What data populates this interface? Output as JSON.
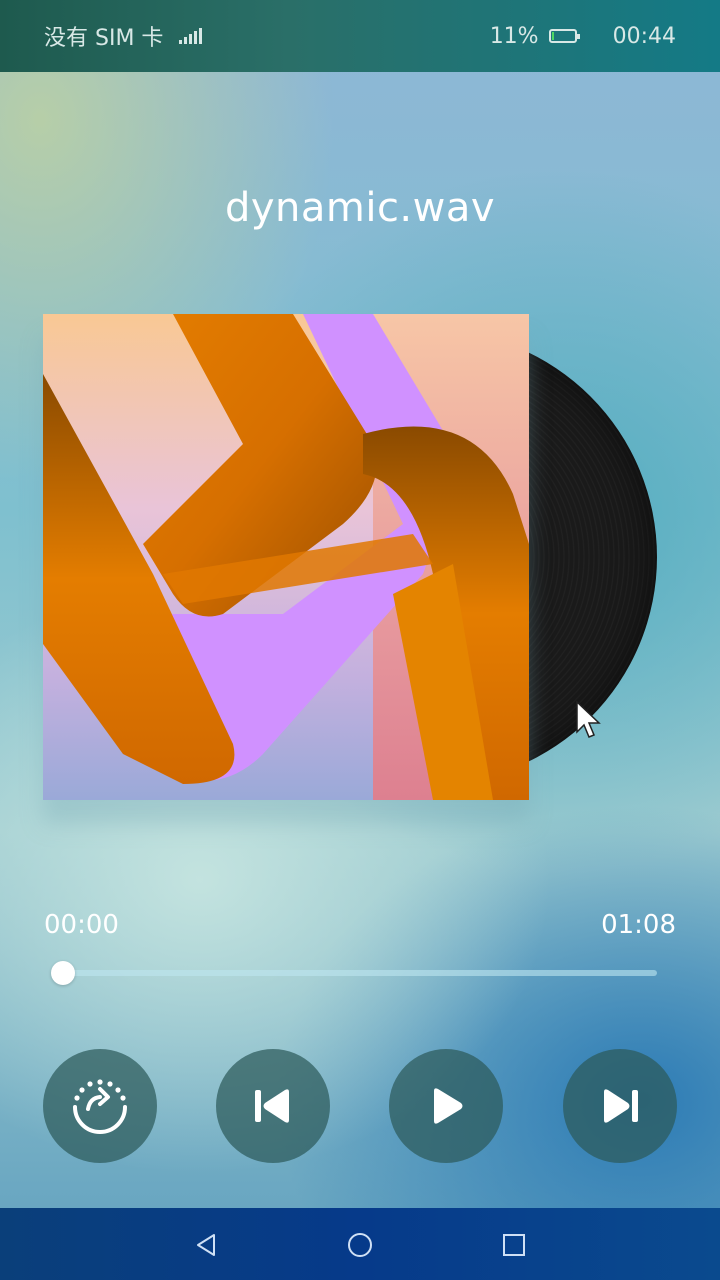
{
  "status_bar": {
    "carrier": "没有 SIM 卡",
    "battery": "11%",
    "time": "00:44"
  },
  "player": {
    "title": "dynamic.wav",
    "current_time": "00:00",
    "total_time": "01:08",
    "progress": 0.0
  },
  "controls": {
    "mode_icon": "repeat-mode-icon",
    "prev_icon": "skip-previous-icon",
    "play_icon": "play-icon",
    "next_icon": "skip-next-icon"
  },
  "navigation": {
    "back_icon": "back-triangle-icon",
    "home_icon": "home-circle-icon",
    "recents_icon": "recents-square-icon"
  },
  "colors": {
    "accent": "#ffffff",
    "control_bg": "#2d5a5a",
    "battery_fill": "#4cd964"
  }
}
